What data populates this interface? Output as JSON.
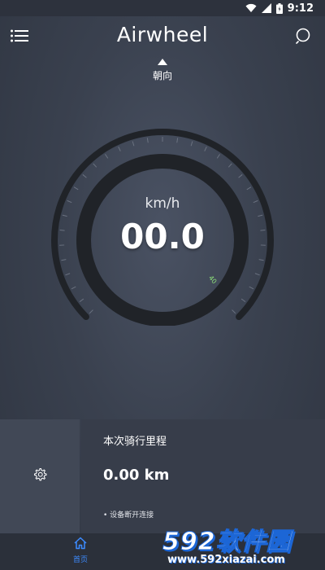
{
  "status_bar": {
    "time": "9:12",
    "icons": [
      "wifi-icon",
      "signal-icon",
      "battery-icon"
    ]
  },
  "app_bar": {
    "title": "Airwheel",
    "menu_icon": "menu-icon",
    "search_icon": "search-icon"
  },
  "direction": {
    "label": "朝向",
    "icon": "up-arrow-icon"
  },
  "speedometer": {
    "unit": "km/h",
    "value": "00.0",
    "max_tick_label": "40",
    "tick_count": 33,
    "arc_color": "#202328",
    "tick_color": "#6b7280",
    "max_label_color": "#8ee07a"
  },
  "trip": {
    "title": "本次骑行里程",
    "value": "0.00 km",
    "status": "• 设备断开连接"
  },
  "settings_tile": {
    "icon": "gear-icon"
  },
  "bottom_nav": {
    "home_label": "首页",
    "home_icon": "home-icon",
    "active_color": "#3d8bff"
  },
  "watermark": {
    "logo": "592软件园",
    "url": "www.592xiazai.com"
  }
}
